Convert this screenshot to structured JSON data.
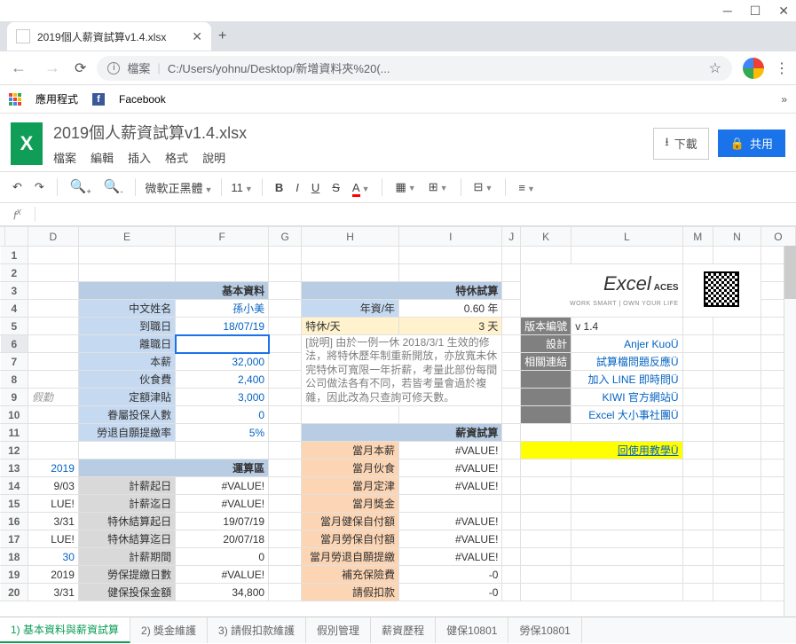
{
  "browser": {
    "tab_title": "2019個人薪資試算v1.4.xlsx",
    "url_prefix": "檔案",
    "url": "C:/Users/yohnu/Desktop/新增資料夾%20(...",
    "bookmark_apps": "應用程式",
    "bookmark_fb": "Facebook"
  },
  "sheets": {
    "title": "2019個人薪資試算v1.4.xlsx",
    "menus": [
      "檔案",
      "編輯",
      "插入",
      "格式",
      "說明"
    ],
    "download": "下載",
    "share": "共用",
    "font": "微軟正黑體",
    "fontsize": "11"
  },
  "columns": [
    "D",
    "E",
    "F",
    "G",
    "H",
    "I",
    "J",
    "K",
    "L",
    "M",
    "N",
    "O"
  ],
  "rows": {
    "r2_section1": "基本資料",
    "r2_section2": "特休試算",
    "r4": {
      "e": "中文姓名",
      "f": "孫小美",
      "h": "年資/年",
      "i": "0.60 年"
    },
    "r5": {
      "e": "到職日",
      "f": "18/07/19",
      "h": "特休/天",
      "i": "3 天",
      "k": "版本編號",
      "l": "v 1.4"
    },
    "r6": {
      "e": "離職日",
      "h_note": "[說明] 由於一例一休 2018/3/1 生效的修法，將特休歷年制重新開放，亦放寬未休完特休可寬限一年折薪，考量此部份每間公司做法各有不同，若皆考量會過於複雜，因此改為只查詢可修天數。",
      "k": "設計",
      "l": "Anjer KuoÜ"
    },
    "r7": {
      "e": "本薪",
      "f": "32,000",
      "k": "相關連結",
      "l": "試算檔問題反應Ü"
    },
    "r8": {
      "e": "伙食費",
      "f": "2,400",
      "l": "加入 LINE 即時問Ü"
    },
    "r9": {
      "d": "假勤",
      "e": "定額津貼",
      "f": "3,000",
      "l": "KIWI 官方網站Ü"
    },
    "r10": {
      "e": "眷屬投保人數",
      "f": "0",
      "l": "Excel 大小事社團Ü"
    },
    "r11": {
      "e": "勞退自願提繳率",
      "f": "5%",
      "h_section": "薪資試算"
    },
    "r12": {
      "h": "當月本薪",
      "i": "#VALUE!",
      "l": "回使用教學Ü"
    },
    "r13": {
      "d": "2019",
      "e": "運算區",
      "h": "當月伙食",
      "i": "#VALUE!"
    },
    "r14": {
      "d": "9/03",
      "e": "計薪起日",
      "f": "#VALUE!",
      "h": "當月定津",
      "i": "#VALUE!"
    },
    "r15": {
      "d": "LUE!",
      "e": "計薪迄日",
      "f": "#VALUE!",
      "h": "當月獎金"
    },
    "r16": {
      "d": "3/31",
      "e": "特休結算起日",
      "f": "19/07/19",
      "h": "當月健保自付額",
      "i": "#VALUE!"
    },
    "r17": {
      "d": "LUE!",
      "e": "特休結算迄日",
      "f": "20/07/18",
      "h": "當月勞保自付額",
      "i": "#VALUE!"
    },
    "r18": {
      "d": "30",
      "e": "計薪期間",
      "f": "0",
      "h": "當月勞退自願提繳",
      "i": "#VALUE!"
    },
    "r19": {
      "d": "2019",
      "e": "勞保提繳日數",
      "f": "#VALUE!",
      "h": "補充保險費",
      "i": "-0"
    },
    "r20": {
      "d": "3/31",
      "e": "健保投保金額",
      "f": "34,800",
      "h": "請假扣款",
      "i": "-0"
    }
  },
  "logo": {
    "main": "Excel",
    "aces": "ACES",
    "tag": "WORK SMART | OWN YOUR LIFE"
  },
  "tabs": [
    "1) 基本資料與薪資試算",
    "2) 獎金維護",
    "3) 請假扣款維護",
    "假別管理",
    "薪資歷程",
    "健保10801",
    "勞保10801"
  ]
}
